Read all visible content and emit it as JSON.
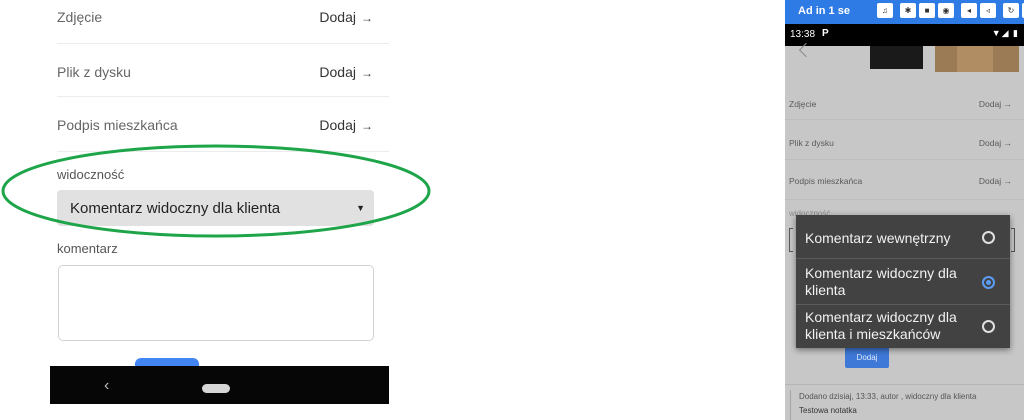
{
  "left_screen": {
    "attachments": [
      {
        "label": "Zdjęcie",
        "action": "Dodaj",
        "arrow": "→"
      },
      {
        "label": "Plik z dysku",
        "action": "Dodaj",
        "arrow": "→"
      },
      {
        "label": "Podpis mieszkańca",
        "action": "Dodaj",
        "arrow": "→"
      }
    ],
    "visibility": {
      "label": "widoczność",
      "selected": "Komentarz widoczny dla klienta",
      "caret": "▼"
    },
    "comment": {
      "label": "komentarz",
      "value": ""
    },
    "nav": {
      "back": "‹"
    },
    "annotation_color": "#1ea54a"
  },
  "right_screen": {
    "ad": {
      "text": "Ad in 1 se"
    },
    "status": {
      "time": "13:38",
      "app_icon": "P",
      "icons": "▼◢ ▮"
    },
    "attachments": [
      {
        "label": "Zdjęcie",
        "action": "Dodaj →"
      },
      {
        "label": "Plik z dysku",
        "action": "Dodaj →"
      },
      {
        "label": "Podpis mieszkańca",
        "action": "Dodaj →"
      }
    ],
    "faint_label": "widoczność",
    "dialog_options": [
      {
        "lines": [
          "Komentarz wewnętrzny"
        ],
        "selected": false
      },
      {
        "lines": [
          "Komentarz widoczny dla",
          "klienta"
        ],
        "selected": true
      },
      {
        "lines": [
          "Komentarz widoczny dla",
          "klienta i mieszkańców"
        ],
        "selected": false
      }
    ],
    "add_button": "Dodaj",
    "note": {
      "meta": "Dodano dzisiaj, 13:33, autor , widoczny dla klienta",
      "body": "Testowa notatka"
    },
    "accent_color": "#2f7be6"
  }
}
